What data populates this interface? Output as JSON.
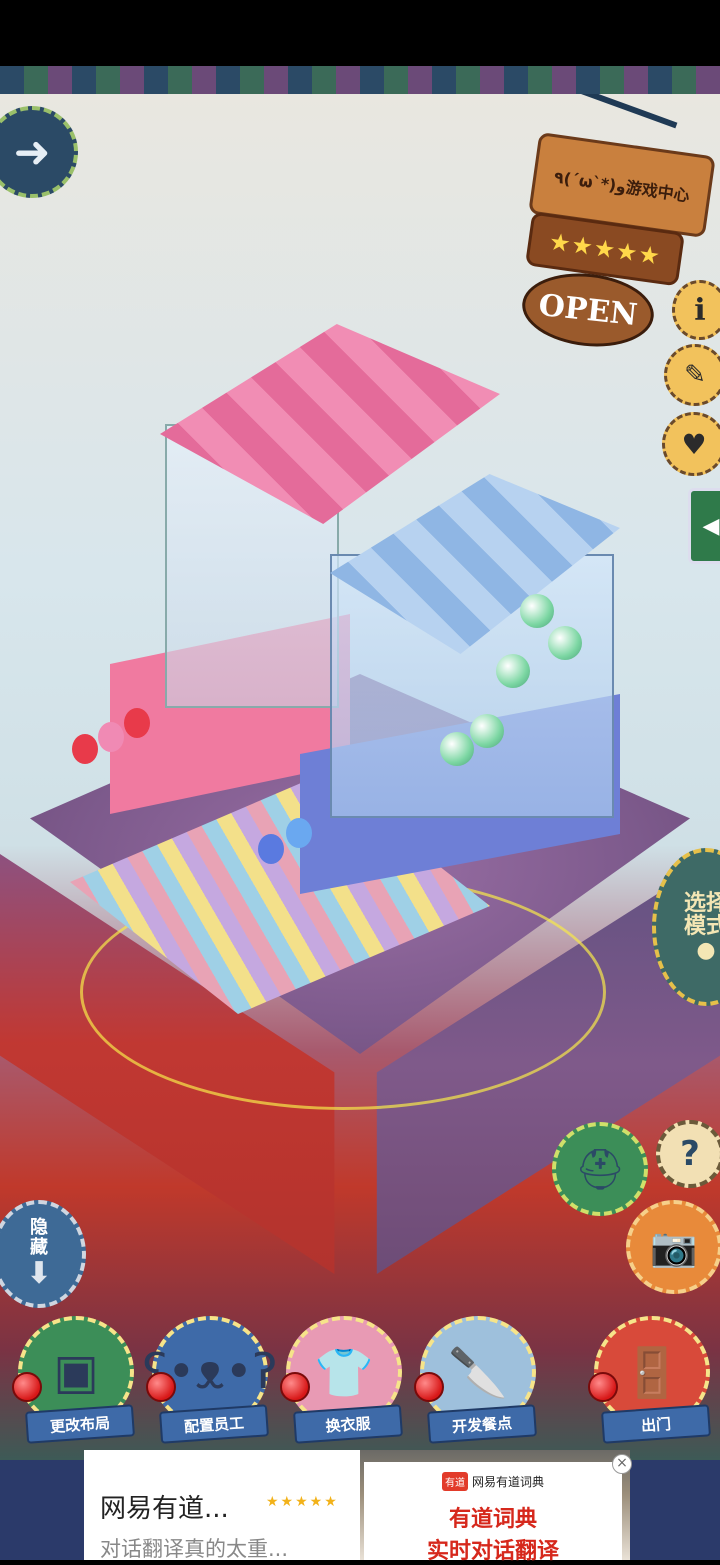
{
  "sign": {
    "name": "٩(ˊωˋ*)و游戏中心",
    "rating": "★★★★★",
    "status": "OPEN"
  },
  "side_menu": {
    "mode_line1": "选择",
    "mode_line2": "模式",
    "hide_line1": "隐",
    "hide_line2": "藏",
    "help": "?"
  },
  "actions": [
    {
      "label": "更改布局",
      "icon": "table-icon",
      "color": "#3c8e58"
    },
    {
      "label": "配置员工",
      "icon": "bear-icon",
      "color": "#3e6aa8"
    },
    {
      "label": "换衣服",
      "icon": "shirt-icon",
      "color": "#e89ab4"
    },
    {
      "label": "开发餐点",
      "icon": "knife-icon",
      "color": "#9ec0dc"
    },
    {
      "label": "出门",
      "icon": "door-icon",
      "color": "#d84a3a"
    }
  ],
  "ad": {
    "title": "网易有道...",
    "stars": "★★★★★",
    "subtitle": "对话翻译真的太重...",
    "brand": "网易有道词典",
    "logo": "有道",
    "headline1": "有道词典",
    "headline2": "实时对话翻译",
    "close": "×"
  },
  "colors": {
    "accent_pink": "#e46b9a",
    "accent_blue": "#8fb6e4",
    "base_purple": "#7d5a8c",
    "base_red": "#c2362f"
  }
}
